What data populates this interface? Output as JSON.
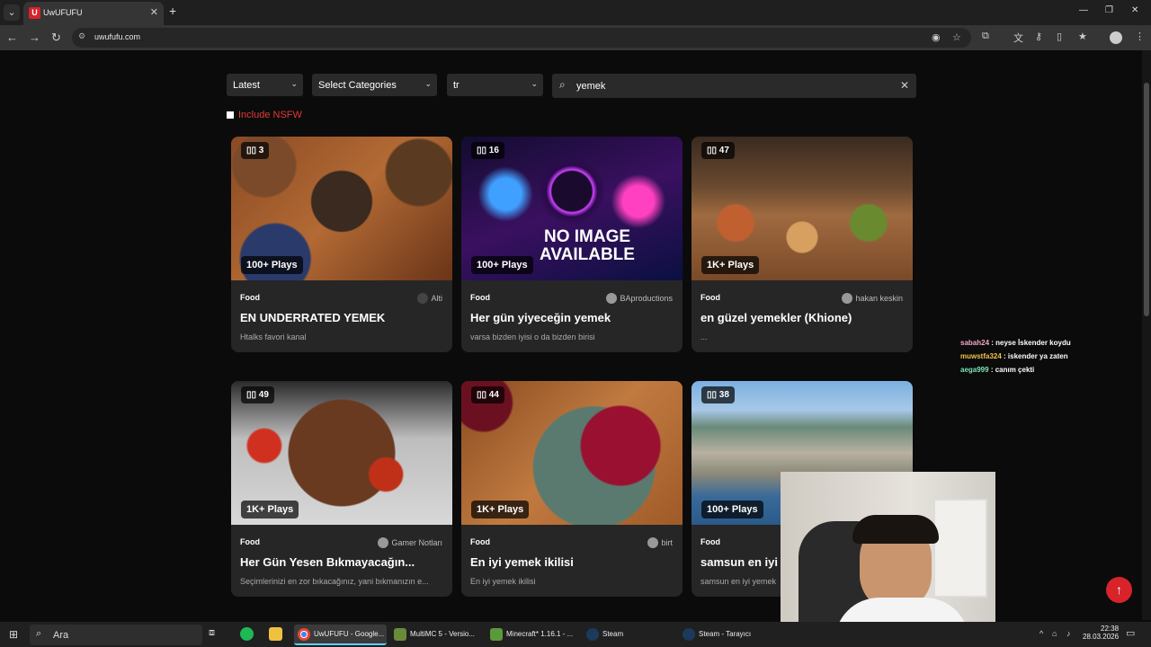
{
  "browser": {
    "tab_title": "UwUFUFU",
    "favicon_letter": "U",
    "url": "uwufufu.com"
  },
  "filters": {
    "sort": "Latest",
    "categories": "Select Categories",
    "language": "tr",
    "search_value": "yemek",
    "nsfw_label": "Include NSFW"
  },
  "cards": [
    {
      "count": "3",
      "plays": "100+ Plays",
      "category": "Food",
      "author": "Alti",
      "title": "EN UNDERRATED YEMEK",
      "desc": "Htalks favori kanal"
    },
    {
      "count": "16",
      "plays": "100+ Plays",
      "category": "Food",
      "author": "BAproductions",
      "title": "Her gün yiyeceğin yemek",
      "desc": "varsa bizden iyisi o da bizden birisi",
      "thumb_text": "NO IMAGE AVAILABLE"
    },
    {
      "count": "47",
      "plays": "1K+ Plays",
      "category": "Food",
      "author": "hakan keskin",
      "title": "en güzel yemekler (Khione)",
      "desc": "..."
    },
    {
      "count": "49",
      "plays": "1K+ Plays",
      "category": "Food",
      "author": "Gamer Notları",
      "title": "Her Gün Yesen Bıkmayacağın...",
      "desc": "Seçimlerinizi en zor bıkacağınız, yani bıkmanızın e..."
    },
    {
      "count": "44",
      "plays": "1K+ Plays",
      "category": "Food",
      "author": "birt",
      "title": "En iyi yemek ikilisi",
      "desc": "En iyi yemek ikilisi"
    },
    {
      "count": "38",
      "plays": "100+ Plays",
      "category": "Food",
      "author": "",
      "title": "samsun en iyi",
      "desc": "samsun en iyi yemek"
    }
  ],
  "chat": [
    {
      "user": "sabah24",
      "msg": " : neyse İskender koydu",
      "color": "#f4a7c9"
    },
    {
      "user": "muwstfa324",
      "msg": " : iskender ya zaten",
      "color": "#f2c14e"
    },
    {
      "user": "aega999",
      "msg": " : canım çekti",
      "color": "#7de3b5"
    }
  ],
  "taskbar": {
    "search": "Ara",
    "items": [
      "UwUFUFU - Google...",
      "MultiMC 5 - Versio...",
      "Minecraft* 1.16.1 - ...",
      "Steam",
      "Steam - Tarayıcı"
    ],
    "time": "22:38",
    "date": "28.03.2026"
  }
}
